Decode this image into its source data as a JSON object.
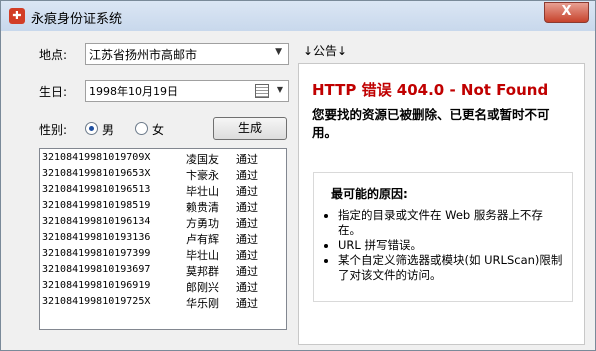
{
  "window": {
    "title": "永痕身份证系统",
    "close_label": "X",
    "app_icon": "app-logo-icon"
  },
  "form": {
    "location_label": "地点:",
    "location_value": "江苏省扬州市高邮市",
    "birthday_label": "生日:",
    "birthday_value": "1998年10月19日",
    "gender_label": "性别:",
    "gender_options": [
      {
        "label": "男",
        "selected": true
      },
      {
        "label": "女",
        "selected": false
      }
    ],
    "generate_label": "生成"
  },
  "results": [
    {
      "id": "32108419981019709X",
      "name": "凌国友",
      "status": "通过"
    },
    {
      "id": "32108419981019653X",
      "name": "卞豪永",
      "status": "通过"
    },
    {
      "id": "321084199810196513",
      "name": "毕壮山",
      "status": "通过"
    },
    {
      "id": "321084199810198519",
      "name": "赖贵清",
      "status": "通过"
    },
    {
      "id": "321084199810196134",
      "name": "方勇功",
      "status": "通过"
    },
    {
      "id": "321084199810193136",
      "name": "卢有辉",
      "status": "通过"
    },
    {
      "id": "321084199810197399",
      "name": "毕壮山",
      "status": "通过"
    },
    {
      "id": "321084199810193697",
      "name": "莫邦群",
      "status": "通过"
    },
    {
      "id": "321084199810196919",
      "name": "郎刚兴",
      "status": "通过"
    },
    {
      "id": "32108419981019725X",
      "name": "华乐刚",
      "status": "通过"
    }
  ],
  "notice": {
    "title": "↓公告↓",
    "error_title": "HTTP 错误 404.0 - Not Found",
    "error_desc": "您要找的资源已被删除、已更名或暂时不可用。",
    "reasons_head": "最可能的原因:",
    "reasons": [
      "指定的目录或文件在 Web 服务器上不存在。",
      "URL 拼写错误。",
      "某个自定义筛选器或模块(如 URLScan)限制了对该文件的访问。"
    ]
  },
  "colors": {
    "error_red": "#c00000",
    "titlebar": "#c8d8ec"
  }
}
